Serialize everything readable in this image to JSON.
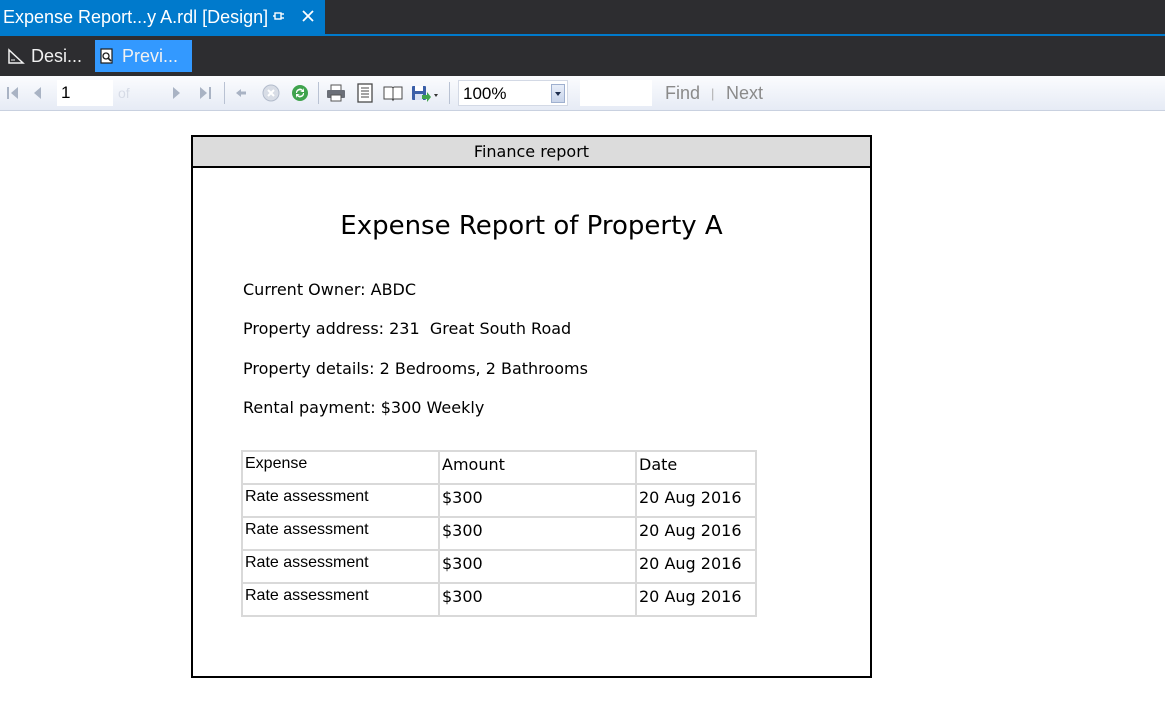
{
  "document_tab": {
    "title": "Expense Report...y A.rdl [Design]"
  },
  "mode_tabs": {
    "design": "Desi...",
    "preview": "Previ..."
  },
  "toolbar": {
    "page_number": "1",
    "of_text": "of",
    "zoom": "100%",
    "find": "Find",
    "separator": "|",
    "next": "Next"
  },
  "report": {
    "header": "Finance report",
    "title": "Expense Report of Property A",
    "owner": "Current Owner: ABDC",
    "address": "Property address: 231  Great South Road",
    "details": "Property details: 2 Bedrooms, 2 Bathrooms",
    "rental": "Rental payment: $300 Weekly",
    "table": {
      "headers": [
        "Expense",
        "Amount",
        "Date"
      ],
      "rows": [
        [
          "Rate assessment",
          "$300",
          "20 Aug 2016"
        ],
        [
          "Rate assessment",
          "$300",
          "20 Aug 2016"
        ],
        [
          "Rate assessment",
          "$300",
          "20 Aug 2016"
        ],
        [
          "Rate assessment",
          "$300",
          "20 Aug 2016"
        ]
      ]
    }
  },
  "colors": {
    "accent": "#007acc",
    "chrome": "#2d2d30",
    "selected_tab": "#3399ff"
  }
}
